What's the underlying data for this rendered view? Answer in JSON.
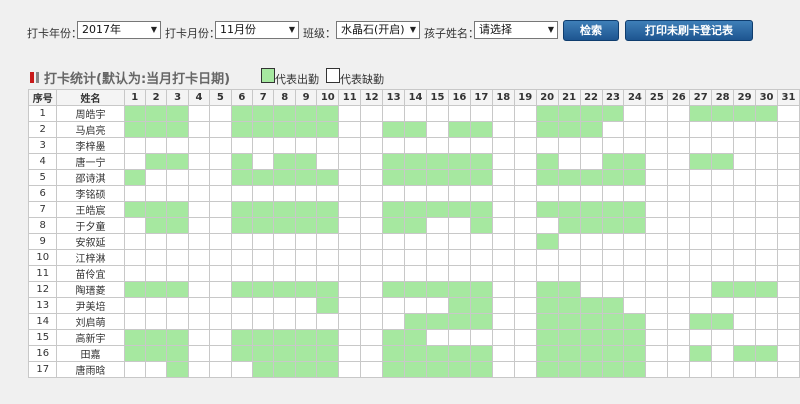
{
  "toolbar": {
    "year_label": "打卡年份：",
    "year_value": "2017年",
    "month_label": "打卡月份：",
    "month_value": "11月份",
    "class_label": "班级：",
    "class_value": "水晶石(开启)",
    "child_label": "孩子姓名：",
    "child_value": "请选择",
    "search_label": "检索",
    "print_label": "打印未刷卡登记表"
  },
  "legend": {
    "title": "打卡统计(默认为:当月打卡日期)",
    "present_label": "代表出勤",
    "absent_label": "代表缺勤",
    "present_color": "#a6e8a0",
    "absent_color": "#ffffff"
  },
  "table": {
    "col_seq": "序号",
    "col_name": "姓名",
    "days": [
      "1",
      "2",
      "3",
      "4",
      "5",
      "6",
      "7",
      "8",
      "9",
      "10",
      "11",
      "12",
      "13",
      "14",
      "15",
      "16",
      "17",
      "18",
      "19",
      "20",
      "21",
      "22",
      "23",
      "24",
      "25",
      "26",
      "27",
      "28",
      "29",
      "30",
      "31"
    ],
    "rows": [
      {
        "seq": "1",
        "name": "周皓宇",
        "present": [
          1,
          2,
          3,
          6,
          7,
          8,
          9,
          10,
          20,
          21,
          22,
          23,
          27,
          28,
          29,
          30
        ]
      },
      {
        "seq": "2",
        "name": "马启亮",
        "present": [
          1,
          2,
          3,
          6,
          7,
          8,
          9,
          10,
          13,
          14,
          16,
          17,
          20,
          21,
          22
        ]
      },
      {
        "seq": "3",
        "name": "李梓墨",
        "present": []
      },
      {
        "seq": "4",
        "name": "唐一宁",
        "present": [
          2,
          3,
          6,
          8,
          9,
          13,
          14,
          15,
          16,
          17,
          20,
          23,
          24,
          27,
          28
        ]
      },
      {
        "seq": "5",
        "name": "邵诗淇",
        "present": [
          1,
          6,
          7,
          8,
          9,
          10,
          13,
          14,
          15,
          16,
          17,
          20,
          21,
          22,
          23,
          24
        ]
      },
      {
        "seq": "6",
        "name": "李铭硕",
        "present": []
      },
      {
        "seq": "7",
        "name": "王皓宸",
        "present": [
          1,
          2,
          3,
          6,
          7,
          8,
          9,
          10,
          13,
          14,
          15,
          16,
          17,
          20,
          21,
          22,
          23,
          24
        ]
      },
      {
        "seq": "8",
        "name": "于夕童",
        "present": [
          2,
          3,
          6,
          7,
          8,
          9,
          10,
          13,
          14,
          17,
          21,
          22,
          23,
          24
        ]
      },
      {
        "seq": "9",
        "name": "安叙延",
        "present": [
          20
        ]
      },
      {
        "seq": "10",
        "name": "江梓淋",
        "present": []
      },
      {
        "seq": "11",
        "name": "苗伶宜",
        "present": []
      },
      {
        "seq": "12",
        "name": "陶瑨菱",
        "present": [
          1,
          2,
          3,
          6,
          7,
          8,
          9,
          10,
          13,
          14,
          15,
          16,
          17,
          20,
          21,
          28,
          29,
          30
        ]
      },
      {
        "seq": "13",
        "name": "尹美培",
        "present": [
          10,
          16,
          17,
          20,
          21,
          22,
          23
        ]
      },
      {
        "seq": "14",
        "name": "刘启萌",
        "present": [
          14,
          15,
          16,
          17,
          20,
          21,
          22,
          23,
          24,
          27,
          28
        ]
      },
      {
        "seq": "15",
        "name": "高新宇",
        "present": [
          1,
          2,
          3,
          6,
          7,
          8,
          9,
          10,
          13,
          14,
          20,
          21,
          22,
          23,
          24
        ]
      },
      {
        "seq": "16",
        "name": "田嘉",
        "present": [
          1,
          2,
          3,
          6,
          7,
          8,
          9,
          10,
          13,
          14,
          15,
          16,
          17,
          20,
          21,
          22,
          23,
          24,
          27,
          29,
          30
        ]
      },
      {
        "seq": "17",
        "name": "唐雨晗",
        "present": [
          3,
          7,
          8,
          9,
          10,
          13,
          14,
          15,
          16,
          17,
          20,
          21,
          22,
          23,
          24
        ]
      }
    ]
  }
}
